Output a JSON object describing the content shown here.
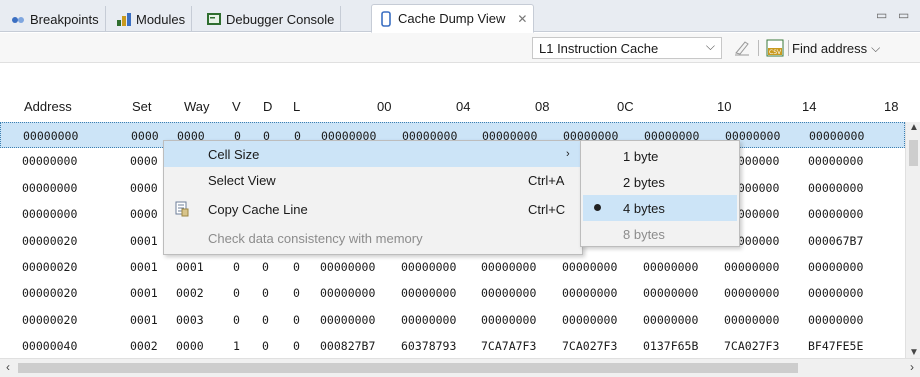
{
  "tabs": [
    {
      "label": "Breakpoints",
      "icon": "breakpoints-icon"
    },
    {
      "label": "Modules",
      "icon": "modules-icon"
    },
    {
      "label": "Debugger Console",
      "icon": "console-icon"
    },
    {
      "label": "Cache Dump View",
      "icon": "cache-view-icon",
      "close": "✕"
    }
  ],
  "window_controls": {
    "minimize": "▭",
    "maximize": "▭"
  },
  "toolbar": {
    "cache_select": "L1 Instruction Cache",
    "find_address": "Find address"
  },
  "table": {
    "headers": [
      "Address",
      "Set",
      "Way",
      "V",
      "D",
      "L",
      "00",
      "04",
      "08",
      "0C",
      "10",
      "14",
      "18"
    ],
    "rows": [
      [
        "00000000",
        "0000",
        "0000",
        "0",
        "0",
        "0",
        "00000000",
        "00000000",
        "00000000",
        "00000000",
        "00000000",
        "00000000",
        "00000000"
      ],
      [
        "00000000",
        "0000",
        "",
        "",
        "",
        "",
        "",
        "",
        "",
        "",
        "",
        "00000000",
        "00000000"
      ],
      [
        "00000000",
        "0000",
        "",
        "",
        "",
        "",
        "",
        "",
        "",
        "",
        "",
        "00000000",
        "00000000"
      ],
      [
        "00000000",
        "0000",
        "",
        "",
        "",
        "",
        "",
        "",
        "",
        "",
        "",
        "00000000",
        "00000000"
      ],
      [
        "00000020",
        "0001",
        "",
        "",
        "",
        "",
        "",
        "",
        "",
        "",
        "",
        "00000000",
        "000067B7"
      ],
      [
        "00000020",
        "0001",
        "0001",
        "0",
        "0",
        "0",
        "00000000",
        "00000000",
        "00000000",
        "00000000",
        "00000000",
        "00000000",
        "00000000"
      ],
      [
        "00000020",
        "0001",
        "0002",
        "0",
        "0",
        "0",
        "00000000",
        "00000000",
        "00000000",
        "00000000",
        "00000000",
        "00000000",
        "00000000"
      ],
      [
        "00000020",
        "0001",
        "0003",
        "0",
        "0",
        "0",
        "00000000",
        "00000000",
        "00000000",
        "00000000",
        "00000000",
        "00000000",
        "00000000"
      ],
      [
        "00000040",
        "0002",
        "0000",
        "1",
        "0",
        "0",
        "000827B7",
        "60378793",
        "7CA7A7F3",
        "7CA027F3",
        "0137F65B",
        "7CA027F3",
        "BF47FE5E"
      ]
    ]
  },
  "context_menu": {
    "items": [
      {
        "label": "Cell Size",
        "shortcut": "",
        "submenu_arrow": "›"
      },
      {
        "label": "Select View",
        "shortcut": "Ctrl+A"
      },
      {
        "label": "Copy Cache Line",
        "shortcut": "Ctrl+C",
        "icon": "copy-icon"
      },
      {
        "label": "Check data consistency with memory",
        "shortcut": "",
        "disabled": true
      }
    ]
  },
  "cell_size_submenu": {
    "items": [
      {
        "label": "1 byte"
      },
      {
        "label": "2 bytes"
      },
      {
        "label": "4 bytes",
        "selected": true
      },
      {
        "label": "8 bytes",
        "disabled": true
      }
    ]
  },
  "colors": {
    "selection": "#cce4f7",
    "tabbar": "#e8ecf2",
    "menu_bg": "#f2f2f2"
  }
}
